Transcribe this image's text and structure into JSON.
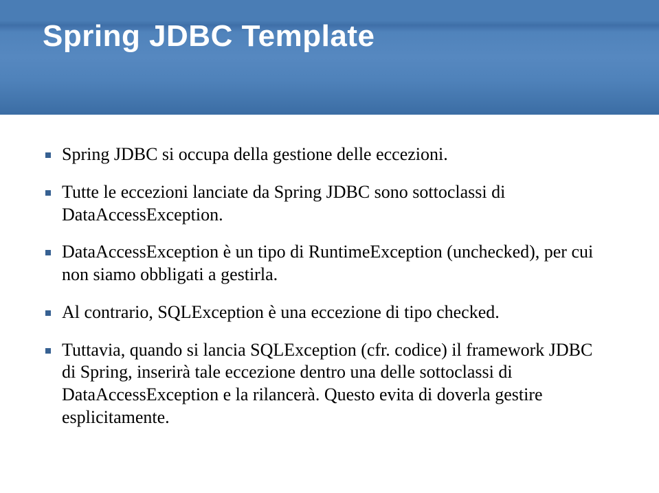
{
  "slide": {
    "title": "Spring JDBC Template",
    "bullets": [
      "Spring JDBC si occupa della gestione delle eccezioni.",
      "Tutte le eccezioni lanciate da Spring JDBC sono sottoclassi di DataAccessException.",
      "DataAccessException è un tipo di RuntimeException (unchecked), per cui non siamo obbligati a gestirla.",
      "Al contrario, SQLException è una eccezione di tipo checked.",
      "Tuttavia, quando si lancia SQLException (cfr. codice) il framework JDBC di Spring, inserirà tale eccezione dentro una delle sottoclassi di DataAccessException e la rilancerà. Questo evita di doverla gestire esplicitamente."
    ]
  }
}
